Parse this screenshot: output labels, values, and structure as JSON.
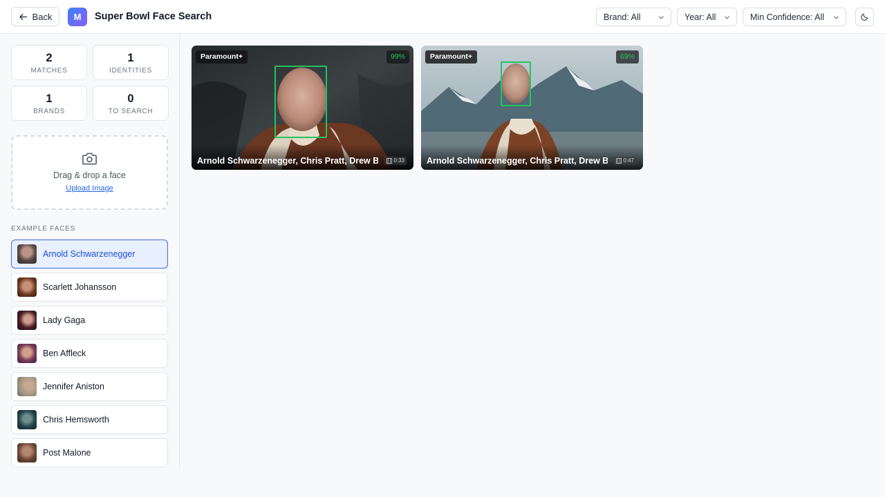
{
  "header": {
    "back_label": "Back",
    "logo_letter": "M",
    "title": "Super Bowl Face Search",
    "filters": {
      "brand": "Brand: All",
      "year": "Year: All",
      "confidence": "Min Confidence: All"
    }
  },
  "stats": [
    {
      "value": "2",
      "label": "MATCHES"
    },
    {
      "value": "1",
      "label": "IDENTITIES"
    },
    {
      "value": "1",
      "label": "BRANDS"
    },
    {
      "value": "0",
      "label": "TO SEARCH"
    }
  ],
  "upload": {
    "prompt": "Drag & drop a face",
    "link": "Upload Image"
  },
  "examples_label": "EXAMPLE FACES",
  "faces": [
    {
      "name": "Arnold Schwarzenegger",
      "active": true
    },
    {
      "name": "Scarlett Johansson",
      "active": false
    },
    {
      "name": "Lady Gaga",
      "active": false
    },
    {
      "name": "Ben Affleck",
      "active": false
    },
    {
      "name": "Jennifer Aniston",
      "active": false
    },
    {
      "name": "Chris Hemsworth",
      "active": false
    },
    {
      "name": "Post Malone",
      "active": false
    }
  ],
  "results": [
    {
      "brand": "Paramount+",
      "confidence": "99%",
      "names": "Arnold Schwarzenegger, Chris Pratt, Drew Barrymore",
      "duration": "0:33"
    },
    {
      "brand": "Paramount+",
      "confidence": "69%",
      "names": "Arnold Schwarzenegger, Chris Pratt, Drew Barrymore",
      "duration": "0:47"
    }
  ],
  "colors": {
    "accent": "#2563eb",
    "match_green": "#22c55e",
    "logo_gradient_start": "#3b82f6",
    "logo_gradient_end": "#8b5cf6"
  }
}
